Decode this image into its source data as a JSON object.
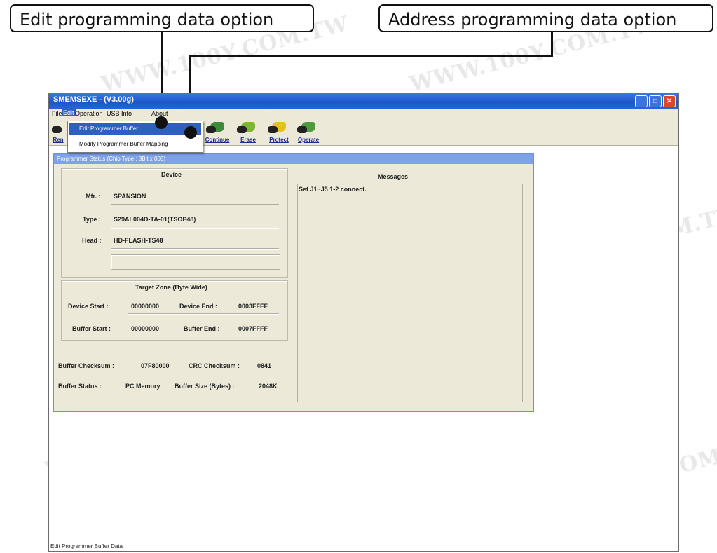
{
  "callouts": {
    "edit": "Edit programming data option",
    "address": "Address programming data option"
  },
  "window": {
    "title": "SMEMSEXE - (V3.00g)",
    "menu": [
      "File",
      "Edit",
      "Operation",
      "USB Info",
      "About"
    ],
    "toolbar": [
      "Ren",
      "Continue",
      "Erase",
      "Protect",
      "Operate"
    ],
    "status": "Edit Programmer Buffer Data"
  },
  "edit_menu": {
    "items": [
      "Edit Programmer Buffer",
      "Modify Programmer Buffer Mapping"
    ]
  },
  "panel": {
    "title": "Programmer Status  (Chip Type : 8Bit x 008)",
    "device": {
      "heading": "Device",
      "mfr_label": "Mfr. :",
      "mfr": "SPANSION",
      "type_label": "Type :",
      "type": "S29AL004D-TA-01(TSOP48)",
      "head_label": "Head :",
      "head": "HD-FLASH-TS48"
    },
    "target": {
      "heading": "Target Zone (Byte Wide)",
      "dev_start_label": "Device Start :",
      "dev_start": "00000000",
      "dev_end_label": "Device End :",
      "dev_end": "0003FFFF",
      "buf_start_label": "Buffer Start :",
      "buf_start": "00000000",
      "buf_end_label": "Buffer End :",
      "buf_end": "0007FFFF"
    },
    "info": {
      "checksum_label": "Buffer Checksum :",
      "checksum": "07F80000",
      "crc_label": "CRC Checksum :",
      "crc": "0841",
      "status_label": "Buffer Status :",
      "status": "PC Memory",
      "size_label": "Buffer Size (Bytes) :",
      "size": "2048K"
    },
    "messages": {
      "heading": "Messages",
      "text": "Set J1~J5 1-2 connect."
    }
  },
  "watermark": "WWW.100Y.COM.TW"
}
